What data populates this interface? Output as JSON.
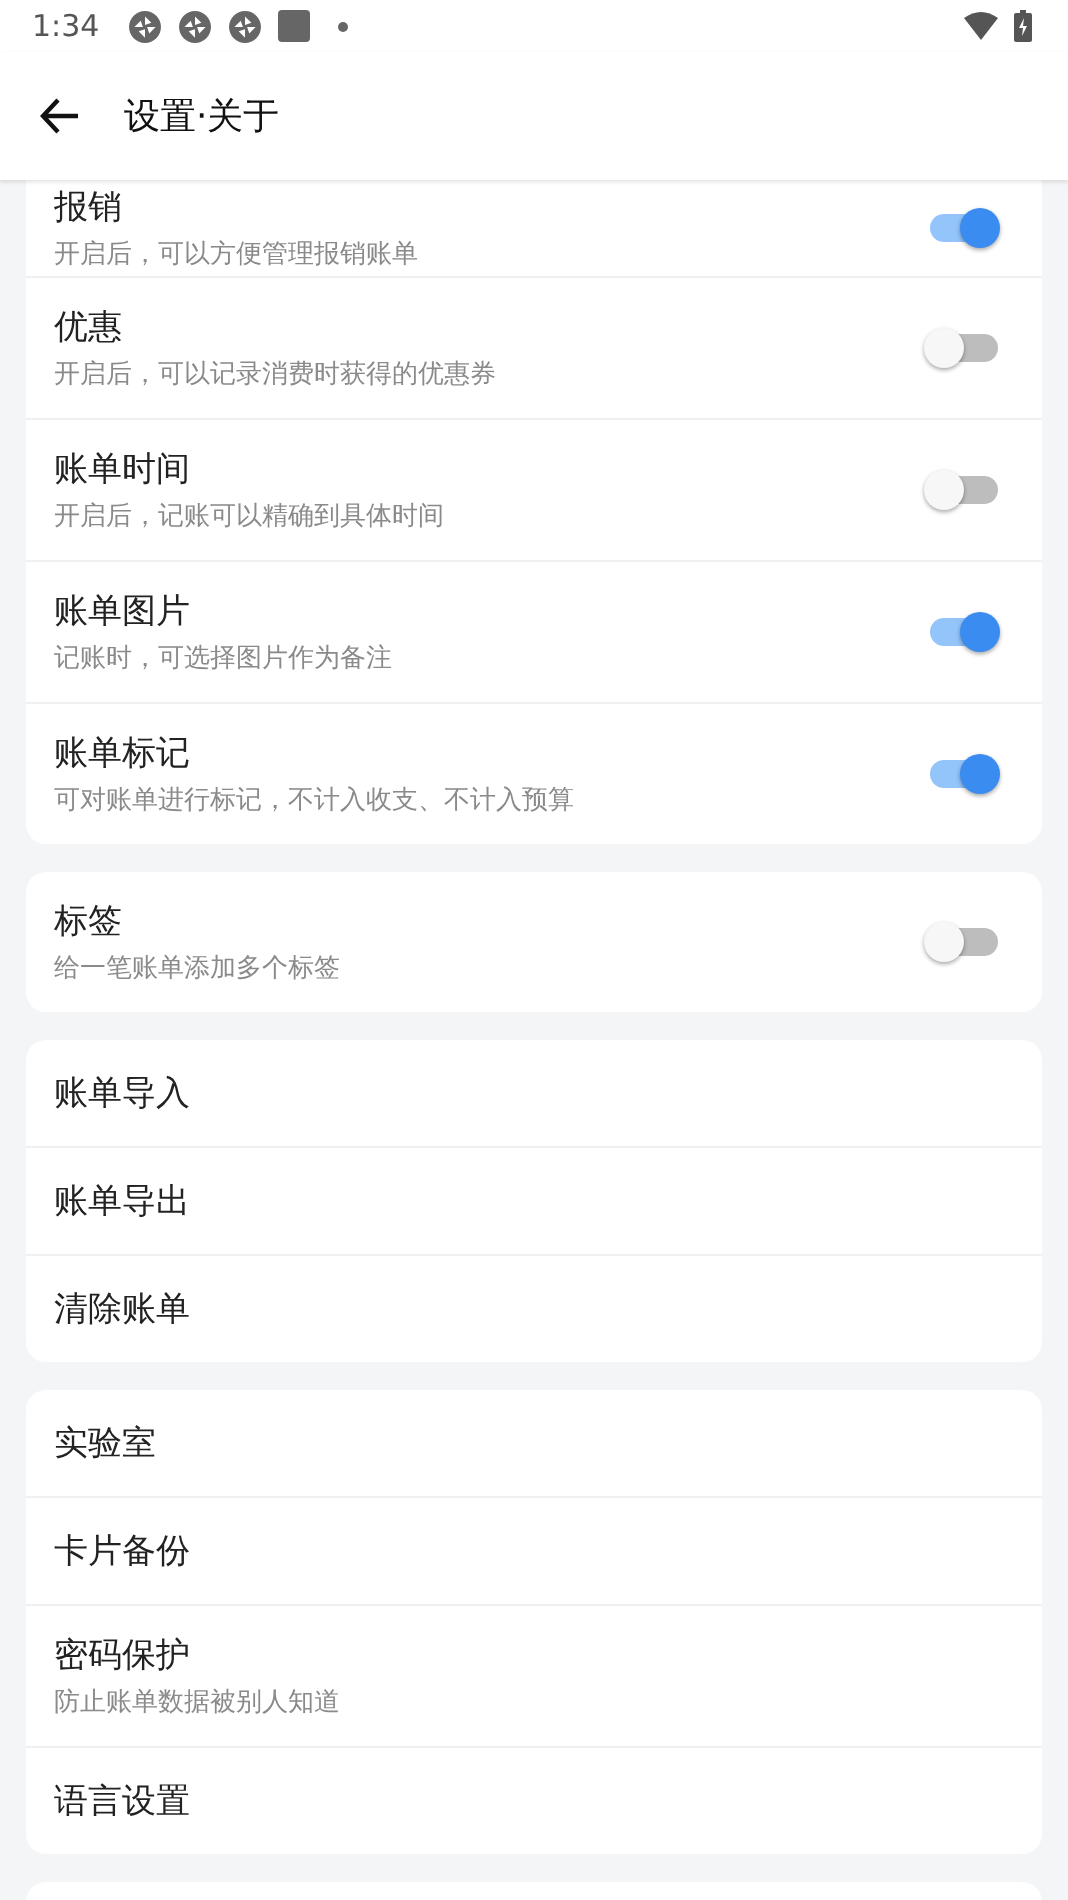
{
  "status_bar": {
    "time": "1:34"
  },
  "app_bar": {
    "title": "设置·关于"
  },
  "sections": [
    {
      "items": [
        {
          "kind": "toggle",
          "title": "报销",
          "subtitle": "开启后，可以方便管理报销账单",
          "on": true
        },
        {
          "kind": "toggle",
          "title": "优惠",
          "subtitle": "开启后，可以记录消费时获得的优惠券",
          "on": false
        },
        {
          "kind": "toggle",
          "title": "账单时间",
          "subtitle": "开启后，记账可以精确到具体时间",
          "on": false
        },
        {
          "kind": "toggle",
          "title": "账单图片",
          "subtitle": "记账时，可选择图片作为备注",
          "on": true
        },
        {
          "kind": "toggle",
          "title": "账单标记",
          "subtitle": "可对账单进行标记，不计入收支、不计入预算",
          "on": true
        }
      ]
    },
    {
      "items": [
        {
          "kind": "toggle",
          "title": "标签",
          "subtitle": "给一笔账单添加多个标签",
          "on": false
        }
      ]
    },
    {
      "items": [
        {
          "kind": "link",
          "title": "账单导入"
        },
        {
          "kind": "link",
          "title": "账单导出"
        },
        {
          "kind": "link",
          "title": "清除账单"
        }
      ]
    },
    {
      "items": [
        {
          "kind": "link",
          "title": "实验室"
        },
        {
          "kind": "link",
          "title": "卡片备份"
        },
        {
          "kind": "link",
          "title": "密码保护",
          "subtitle": "防止账单数据被别人知道"
        },
        {
          "kind": "link",
          "title": "语言设置"
        }
      ]
    }
  ]
}
